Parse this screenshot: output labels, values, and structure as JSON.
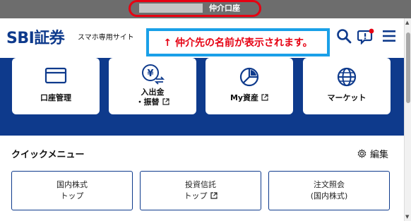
{
  "top_bar": {
    "broker_label": "仲介口座"
  },
  "header": {
    "logo": "SBI証券",
    "logo_sub": "スマホ専用サイト",
    "icons": [
      "search-icon",
      "chat-notification-icon",
      "hamburger-menu-icon"
    ],
    "notification_dot_color": "#e60012"
  },
  "annotation": {
    "text": "↑ 仲介先の名前が表示されます。"
  },
  "tiles": [
    {
      "label": "口座管理",
      "icon": "card-icon"
    },
    {
      "label_line1": "入出金",
      "label_line2": "・振替",
      "icon": "yen-transfer-icon",
      "external": true
    },
    {
      "label": "My資産",
      "icon": "pie-chart-icon",
      "external": true
    },
    {
      "label": "マーケット",
      "icon": "globe-icon"
    }
  ],
  "quick_menu": {
    "title": "クイックメニュー",
    "edit_label": "編集",
    "buttons": [
      {
        "line1": "国内株式",
        "line2": "トップ"
      },
      {
        "line1": "投資信託",
        "line2": "トップ",
        "external": true
      },
      {
        "line1": "注文照会",
        "line2": "(国内株式)"
      }
    ]
  },
  "colors": {
    "navy": "#0e3a8c",
    "red": "#e60012",
    "annotation_border": "#1aa0e8",
    "topbar": "#6d6d6d"
  }
}
